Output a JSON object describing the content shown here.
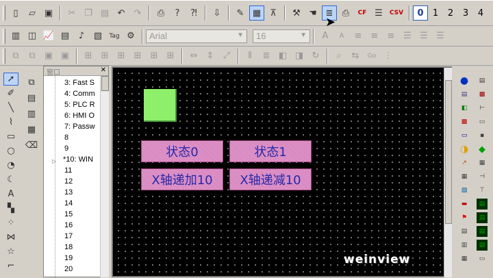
{
  "colors": {
    "canvas_bg": "#000000",
    "shape_fill": "#8ef06a",
    "button_fill": "#d886c0",
    "button_text": "#2828a8"
  },
  "toolbar1": {
    "tools": [
      {
        "name": "new-file-icon",
        "glyph": "▯"
      },
      {
        "name": "open-folder-icon",
        "glyph": "📂"
      },
      {
        "name": "save-icon",
        "glyph": "💾"
      },
      {
        "name": "cut-icon",
        "glyph": "✂"
      },
      {
        "name": "copy-icon",
        "glyph": "❐"
      },
      {
        "name": "paste-icon",
        "glyph": "📋"
      },
      {
        "name": "undo-icon",
        "glyph": "↶"
      },
      {
        "name": "redo-icon",
        "glyph": "↷"
      },
      {
        "name": "print-icon",
        "glyph": "🖶"
      },
      {
        "name": "help-icon",
        "glyph": "?"
      },
      {
        "name": "context-help-icon",
        "glyph": "¿"
      },
      {
        "name": "download-icon",
        "glyph": "⬇"
      },
      {
        "name": "edit-pen-icon",
        "glyph": "✎"
      },
      {
        "name": "grid-icon",
        "glyph": "▦"
      },
      {
        "name": "align-icon",
        "glyph": "⊼"
      },
      {
        "name": "compile-hammer-icon",
        "glyph": "⚒"
      },
      {
        "name": "hand-icon",
        "glyph": "✋"
      },
      {
        "name": "document-icon",
        "glyph": "≣"
      },
      {
        "name": "printer-icon",
        "glyph": "⎙"
      }
    ],
    "cf_label": "CF",
    "csv_label": "CSV",
    "numbers": [
      "0",
      "1",
      "2",
      "3",
      "4"
    ],
    "active_number": "0"
  },
  "toolbar2": {
    "font_name": "Arial",
    "font_size": "16",
    "format_tools": [
      "A",
      "A",
      "≡",
      "≡",
      "≡",
      "≡",
      "≡",
      "≡",
      "≡"
    ]
  },
  "tree_panel": {
    "title": "窗口",
    "items": [
      "3: Fast S",
      "4: Comm",
      "5: PLC R",
      "6: HMI O",
      "7: Passw",
      "8",
      "9",
      "*10: WIN",
      "11",
      "12",
      "13",
      "14",
      "15",
      "16",
      "17",
      "18",
      "19",
      "20"
    ]
  },
  "buttons": [
    {
      "label": "状态0"
    },
    {
      "label": "状态1"
    },
    {
      "label": "X轴递加10"
    },
    {
      "label": "X轴递减10"
    }
  ],
  "watermark": "weinview"
}
